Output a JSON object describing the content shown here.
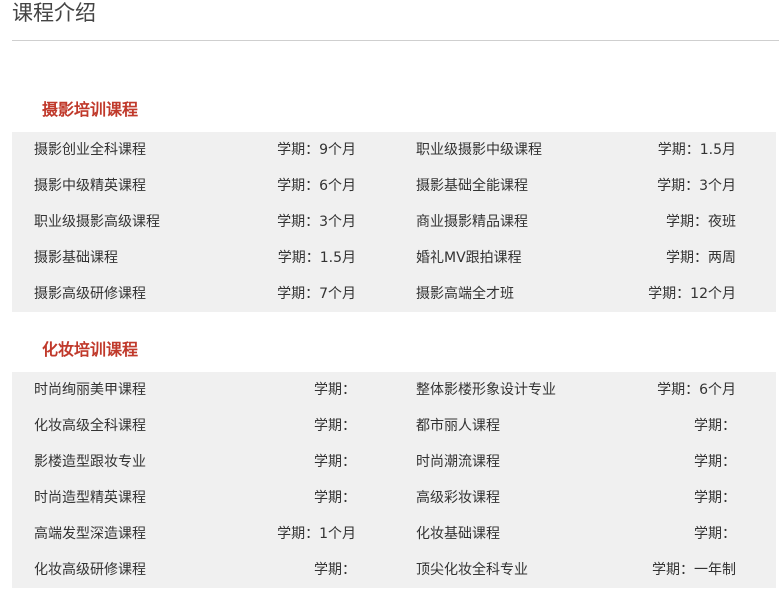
{
  "page": {
    "title": "课程介绍"
  },
  "sections": [
    {
      "title": "摄影培训课程",
      "rows": [
        {
          "left_name": "摄影创业全科课程",
          "left_term": "学期：9个月",
          "right_name": "职业级摄影中级课程",
          "right_term": "学期：1.5月"
        },
        {
          "left_name": "摄影中级精英课程",
          "left_term": "学期：6个月",
          "right_name": "摄影基础全能课程",
          "right_term": "学期：3个月"
        },
        {
          "left_name": "职业级摄影高级课程",
          "left_term": "学期：3个月",
          "right_name": "商业摄影精品课程",
          "right_term": "学期：夜班"
        },
        {
          "left_name": "摄影基础课程",
          "left_term": "学期：1.5月",
          "right_name": "婚礼MV跟拍课程",
          "right_term": "学期：两周"
        },
        {
          "left_name": "摄影高级研修课程",
          "left_term": "学期：7个月",
          "right_name": "摄影高端全才班",
          "right_term": "学期：12个月"
        }
      ]
    },
    {
      "title": "化妆培训课程",
      "rows": [
        {
          "left_name": "时尚绚丽美甲课程",
          "left_term": "学期：",
          "right_name": "整体影楼形象设计专业",
          "right_term": "学期：6个月"
        },
        {
          "left_name": "化妆高级全科课程",
          "left_term": "学期：",
          "right_name": "都市丽人课程",
          "right_term": "学期："
        },
        {
          "left_name": "影楼造型跟妆专业",
          "left_term": "学期：",
          "right_name": "时尚潮流课程",
          "right_term": "学期："
        },
        {
          "left_name": "时尚造型精英课程",
          "left_term": "学期：",
          "right_name": "高级彩妆课程",
          "right_term": "学期："
        },
        {
          "left_name": "高端发型深造课程",
          "left_term": "学期：1个月",
          "right_name": "化妆基础课程",
          "right_term": "学期："
        },
        {
          "left_name": "化妆高级研修课程",
          "left_term": "学期：",
          "right_name": "顶尖化妆全科专业",
          "right_term": "学期：一年制"
        }
      ]
    }
  ]
}
